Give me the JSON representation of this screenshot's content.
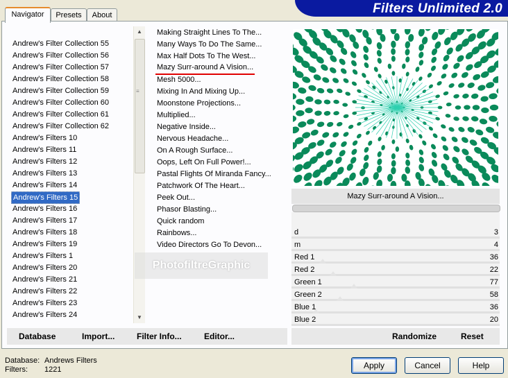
{
  "tabs": [
    {
      "label": "Navigator",
      "active": true
    },
    {
      "label": "Presets",
      "active": false
    },
    {
      "label": "About",
      "active": false
    }
  ],
  "banner_title": "Filters Unlimited 2.0",
  "categories": [
    "Andrew's Filter Collection 55",
    "Andrew's Filter Collection 56",
    "Andrew's Filter Collection 57",
    "Andrew's Filter Collection 58",
    "Andrew's Filter Collection 59",
    "Andrew's Filter Collection 60",
    "Andrew's Filter Collection 61",
    "Andrew's Filter Collection 62",
    "Andrew's Filters 10",
    "Andrew's Filters 11",
    "Andrew's Filters 12",
    "Andrew's Filters 13",
    "Andrew's Filters 14",
    "Andrew's Filters 15",
    "Andrew's Filters 16",
    "Andrew's Filters 17",
    "Andrew's Filters 18",
    "Andrew's Filters 19",
    "Andrew's Filters 1",
    "Andrew's Filters 20",
    "Andrew's Filters 21",
    "Andrew's Filters 22",
    "Andrew's Filters 23",
    "Andrew's Filters 24"
  ],
  "selected_category": "Andrew's Filters 15",
  "filters": [
    "Making Straight Lines To The...",
    "Many Ways To Do The Same...",
    "Max Half Dots To The West...",
    "Mazy Surr-around A Vision...",
    "Mesh 5000...",
    "Mixing In And Mixing Up...",
    "Moonstone Projections...",
    "Multiplied...",
    "Negative Inside...",
    "Nervous Headache...",
    "On A Rough Surface...",
    "Oops, Left On Full Power!...",
    "Pastal Flights Of Miranda Fancy...",
    "Patchwork Of The Heart...",
    "Peek Out...",
    "Phasor Blasting...",
    "Quick random",
    "Rainbows...",
    "Video Directors Go To Devon..."
  ],
  "selected_filter": "Mazy Surr-around A Vision...",
  "watermark": "PhotofiltreGraphic",
  "preview_filter_name": "Mazy Surr-around A Vision...",
  "parameters": [
    {
      "label": "d",
      "value": "3"
    },
    {
      "label": "m",
      "value": "4"
    },
    {
      "label": "Red 1",
      "value": "36"
    },
    {
      "label": "Red 2",
      "value": "22"
    },
    {
      "label": "Green 1",
      "value": "77"
    },
    {
      "label": "Green 2",
      "value": "58"
    },
    {
      "label": "Blue 1",
      "value": "36"
    },
    {
      "label": "Blue 2",
      "value": "20"
    }
  ],
  "toolbar": {
    "database": "Database",
    "import": "Import...",
    "filter_info": "Filter Info...",
    "editor": "Editor...",
    "randomize": "Randomize",
    "reset": "Reset"
  },
  "status": {
    "database_label": "Database:",
    "database_value": "Andrews Filters",
    "filters_label": "Filters:",
    "filters_value": "1221"
  },
  "buttons": {
    "apply": "Apply",
    "cancel": "Cancel",
    "help": "Help"
  },
  "colors": {
    "banner": "#0a1aa0",
    "selection": "#316ac5",
    "underline": "#e00000",
    "preview_dots": "#0a8a5a"
  }
}
